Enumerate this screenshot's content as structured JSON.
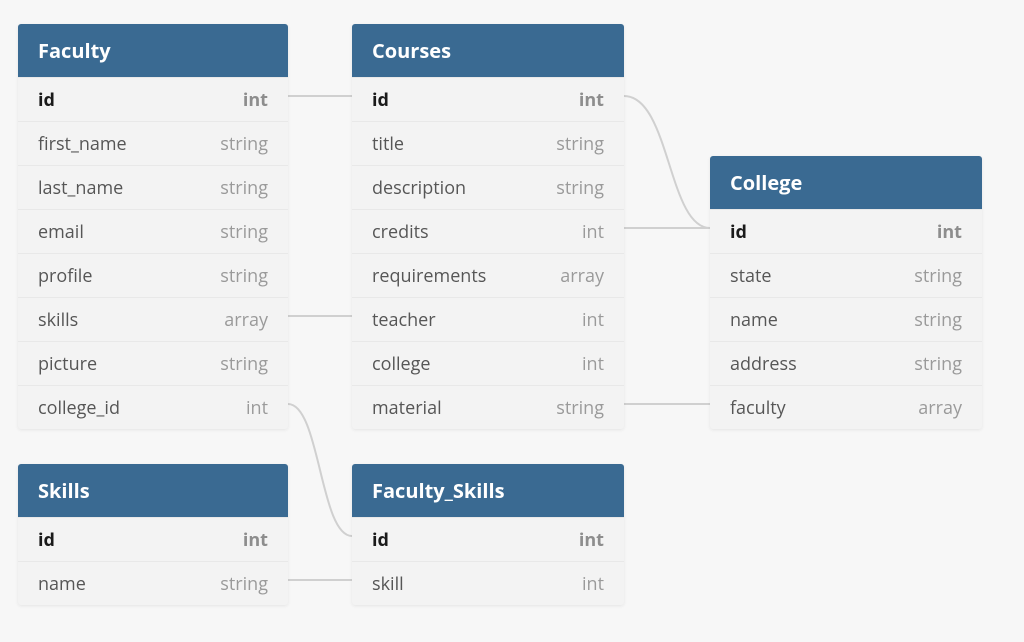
{
  "entities": {
    "faculty": {
      "title": "Faculty",
      "rows": [
        {
          "name": "id",
          "type": "int",
          "pk": true
        },
        {
          "name": "first_name",
          "type": "string"
        },
        {
          "name": "last_name",
          "type": "string"
        },
        {
          "name": "email",
          "type": "string"
        },
        {
          "name": "profile",
          "type": "string"
        },
        {
          "name": "skills",
          "type": "array"
        },
        {
          "name": "picture",
          "type": "string"
        },
        {
          "name": "college_id",
          "type": "int"
        }
      ]
    },
    "courses": {
      "title": "Courses",
      "rows": [
        {
          "name": "id",
          "type": "int",
          "pk": true
        },
        {
          "name": "title",
          "type": "string"
        },
        {
          "name": "description",
          "type": "string"
        },
        {
          "name": "credits",
          "type": "int"
        },
        {
          "name": "requirements",
          "type": "array"
        },
        {
          "name": "teacher",
          "type": "int"
        },
        {
          "name": "college",
          "type": "int"
        },
        {
          "name": "material",
          "type": "string"
        }
      ]
    },
    "college": {
      "title": "College",
      "rows": [
        {
          "name": "id",
          "type": "int",
          "pk": true
        },
        {
          "name": "state",
          "type": "string"
        },
        {
          "name": "name",
          "type": "string"
        },
        {
          "name": "address",
          "type": "string"
        },
        {
          "name": "faculty",
          "type": "array"
        }
      ]
    },
    "skills": {
      "title": "Skills",
      "rows": [
        {
          "name": "id",
          "type": "int",
          "pk": true
        },
        {
          "name": "name",
          "type": "string"
        }
      ]
    },
    "faculty_skills": {
      "title": "Faculty_Skills",
      "rows": [
        {
          "name": "id",
          "type": "int",
          "pk": true
        },
        {
          "name": "skill",
          "type": "int"
        }
      ]
    }
  },
  "connectors": [
    {
      "from": "faculty.id",
      "to": "courses.id"
    },
    {
      "from": "faculty.skills",
      "to": "courses.teacher"
    },
    {
      "from": "faculty.college_id",
      "to": "faculty_skills.id"
    },
    {
      "from": "courses.id",
      "to": "college.id"
    },
    {
      "from": "courses.credits",
      "to": "college.id"
    },
    {
      "from": "courses.material",
      "to": "college.faculty"
    },
    {
      "from": "skills.name",
      "to": "faculty_skills.skill"
    }
  ]
}
